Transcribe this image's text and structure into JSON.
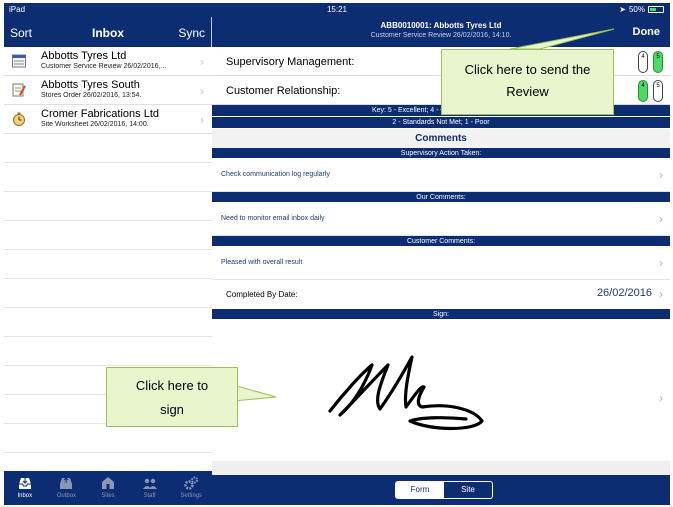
{
  "status_bar": {
    "device": "iPad",
    "time": "15:21",
    "battery": "50%",
    "battery_level": 0.5
  },
  "left_pane": {
    "header": {
      "sort": "Sort",
      "title": "Inbox",
      "sync": "Sync"
    },
    "items": [
      {
        "title": "Abbotts Tyres Ltd",
        "subtitle": "Customer Service Review 26/02/2016,...",
        "icon": "form-icon"
      },
      {
        "title": "Abbotts Tyres South",
        "subtitle": "Stores Order 26/02/2016, 13:54.",
        "icon": "notepad-icon"
      },
      {
        "title": "Cromer Fabrications Ltd",
        "subtitle": "Site Worksheet 26/02/2016, 14:00.",
        "icon": "stopwatch-icon"
      }
    ],
    "tabs": [
      {
        "label": "Inbox",
        "icon": "inbox-icon",
        "active": true
      },
      {
        "label": "Outbox",
        "icon": "outbox-icon",
        "active": false
      },
      {
        "label": "Sites",
        "icon": "building-icon",
        "active": false
      },
      {
        "label": "Staff",
        "icon": "people-icon",
        "active": false
      },
      {
        "label": "Settings",
        "icon": "gears-icon",
        "active": false
      }
    ]
  },
  "right_pane": {
    "header": {
      "title": "ABB0010001: Abbotts Tyres Ltd",
      "subtitle": "Customer Service Review 26/02/2016, 14:10.",
      "done": "Done"
    },
    "ratings": [
      {
        "label": "Supervisory Management:",
        "pills": [
          "4",
          "5"
        ],
        "selected": "5"
      },
      {
        "label": "Customer Relationship:",
        "pills": [
          "4",
          "5"
        ],
        "selected": "4"
      }
    ],
    "key_line1": "Key: 5 - Excellent; 4 - Good; 3 - Satisfactory;",
    "key_line2": "2 - Standards Not Met; 1 - Poor",
    "comments_title": "Comments",
    "supervisory_bar": "Supervisory Action Taken:",
    "supervisory_value": "Check communication log regularly",
    "our_bar": "Our Comments:",
    "our_value": "Need to monitor email inbox daily",
    "customer_bar": "Customer Comments:",
    "customer_value": "Pleased with overall result",
    "completed_label": "Completed By Date:",
    "completed_value": "26/02/2016",
    "sign_bar": "Sign:",
    "segment": {
      "form": "Form",
      "site": "Site",
      "active": "Form"
    }
  },
  "callouts": {
    "send": "Click here to send the Review",
    "sign": "Click here to sign"
  },
  "colors": {
    "navy": "#0d2d73",
    "callout_bg": "#e9f6cd",
    "green": "#4cd964"
  }
}
